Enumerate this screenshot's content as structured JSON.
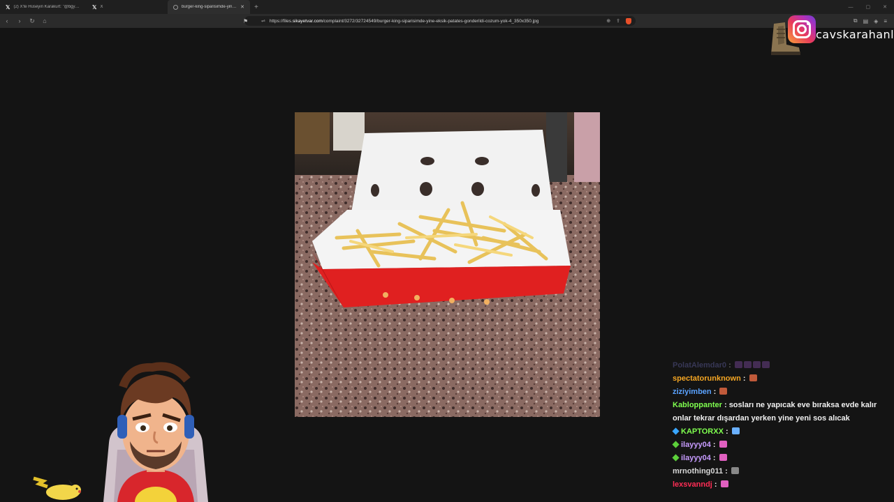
{
  "browser": {
    "tabs": [
      {
        "title": "(2) X'te Hüseyin Karakurt: \"@bgyeth..."
      },
      {
        "title": "X"
      },
      {
        "title": "burger-king-siparisimde-yine-ek..."
      }
    ],
    "address": {
      "url_prefix": "https://files.",
      "url_domain": "sikayetvar.com",
      "url_path": "/complaint/3272/32724549/burger-king-siparisimde-yine-eksik-patates-gonderildi-cozum-yok-4_350x350.jpg"
    }
  },
  "overlay": {
    "instagram_handle": "cavskarahanli"
  },
  "chat": {
    "messages": [
      {
        "user": "PolatAlemdar0",
        "color": "#7a7ad0",
        "text": "",
        "emotes": [
          "#9a5ac8",
          "#9a5ac8",
          "#9a5ac8",
          "#9a5ac8"
        ],
        "faded": true
      },
      {
        "user": "spectatorunknown",
        "color": "#f5a623",
        "text": "",
        "emotes": [
          "#c05a3a"
        ]
      },
      {
        "user": "ziziyimben",
        "color": "#5aa2ff",
        "text": "",
        "emotes": [
          "#c05a3a"
        ]
      },
      {
        "user": "Kabloppanter",
        "color": "#7fff4f",
        "text": "sosları ne yapıcak eve bıraksa evde kalır onlar tekrar dışardan yerken yine yeni sos alıcak",
        "emotes": []
      },
      {
        "user": "KAPTORXX",
        "color": "#7fff4f",
        "text": "",
        "emotes": [
          "#6ab0ff"
        ],
        "badge": "#39a6ff"
      },
      {
        "user": "ilayyy04",
        "color": "#c79bff",
        "text": "",
        "emotes": [
          "#e060c0"
        ],
        "badge": "#5ccf3a"
      },
      {
        "user": "ilayyy04",
        "color": "#c79bff",
        "text": "",
        "emotes": [
          "#e060c0"
        ],
        "badge": "#5ccf3a"
      },
      {
        "user": "mrnothing011",
        "color": "#d8d8d8",
        "text": "",
        "emotes": [
          "#888888"
        ]
      },
      {
        "user": "lexsvanndj",
        "color": "#ff2d55",
        "text": "",
        "emotes": [
          "#e060c0"
        ]
      }
    ]
  }
}
